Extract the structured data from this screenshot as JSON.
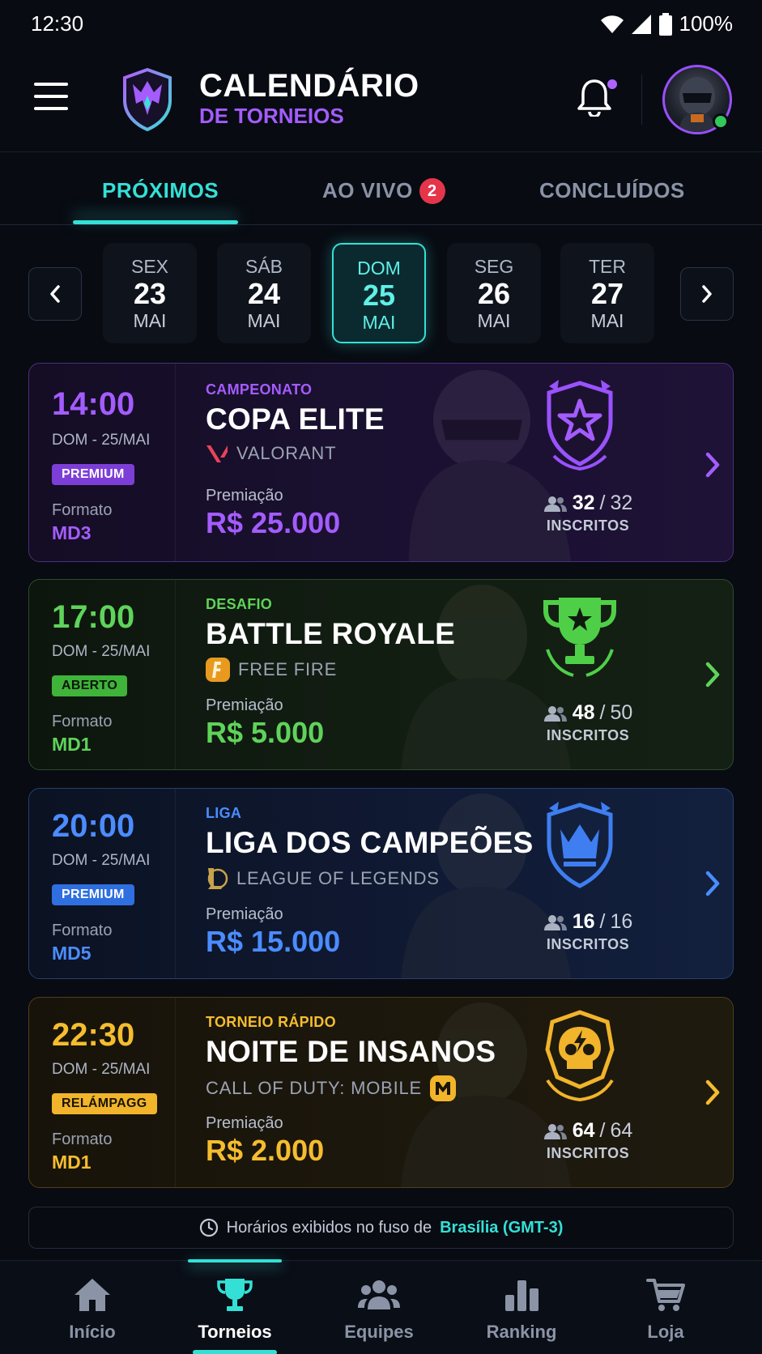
{
  "status_bar": {
    "time": "12:30",
    "battery": "100%"
  },
  "header": {
    "title_line1": "CALENDÁRIO",
    "title_line2": "DE TORNEIOS"
  },
  "tabs": [
    {
      "label": "PRÓXIMOS",
      "active": true
    },
    {
      "label": "AO VIVO",
      "badge": "2",
      "active": false
    },
    {
      "label": "CONCLUÍDOS",
      "active": false
    }
  ],
  "dates": [
    {
      "weekday": "SEX",
      "day": "23",
      "month": "MAI",
      "active": false
    },
    {
      "weekday": "SÁB",
      "day": "24",
      "month": "MAI",
      "active": false
    },
    {
      "weekday": "DOM",
      "day": "25",
      "month": "MAI",
      "active": true
    },
    {
      "weekday": "SEG",
      "day": "26",
      "month": "MAI",
      "active": false
    },
    {
      "weekday": "TER",
      "day": "27",
      "month": "MAI",
      "active": false
    }
  ],
  "tournaments": [
    {
      "time": "14:00",
      "date": "DOM - 25/MAI",
      "badge": "PREMIUM",
      "format_label": "Formato",
      "format": "MD3",
      "category": "CAMPEONATO",
      "name": "COPA ELITE",
      "game": "VALORANT",
      "game_icon": "valorant-icon",
      "prize_label": "Premiação",
      "prize": "R$ 25.000",
      "registered": "32",
      "capacity": "32",
      "registered_label": "INSCRITOS",
      "accent": "#a45cff",
      "emblem": "star-shield-icon"
    },
    {
      "time": "17:00",
      "date": "DOM - 25/MAI",
      "badge": "ABERTO",
      "format_label": "Formato",
      "format": "MD1",
      "category": "DESAFIO",
      "name": "BATTLE ROYALE",
      "game": "FREE FIRE",
      "game_icon": "free-fire-icon",
      "prize_label": "Premiação",
      "prize": "R$ 5.000",
      "registered": "48",
      "capacity": "50",
      "registered_label": "INSCRITOS",
      "accent": "#5fd35a",
      "emblem": "trophy-icon"
    },
    {
      "time": "20:00",
      "date": "DOM - 25/MAI",
      "badge": "PREMIUM",
      "format_label": "Formato",
      "format": "MD5",
      "category": "LIGA",
      "name": "LIGA DOS CAMPEÕES",
      "game": "LEAGUE OF LEGENDS",
      "game_icon": "league-icon",
      "prize_label": "Premiação",
      "prize": "R$ 15.000",
      "registered": "16",
      "capacity": "16",
      "registered_label": "INSCRITOS",
      "accent": "#4b8cff",
      "emblem": "crown-shield-icon"
    },
    {
      "time": "22:30",
      "date": "DOM - 25/MAI",
      "badge": "RELÁMPAGG",
      "format_label": "Formato",
      "format": "MD1",
      "category": "TORNEIO RÁPIDO",
      "name": "NOITE DE INSANOS",
      "game": "CALL OF DUTY: MOBILE",
      "game_icon": "cod-mobile-icon",
      "prize_label": "Premiação",
      "prize": "R$ 2.000",
      "registered": "64",
      "capacity": "64",
      "registered_label": "INSCRITOS",
      "accent": "#f5bd2e",
      "emblem": "skull-icon"
    }
  ],
  "timezone_note": {
    "text": "Horários exibidos no fuso de",
    "zone": "Brasília (GMT-3)"
  },
  "bottom_nav": [
    {
      "label": "Início",
      "icon": "home-icon",
      "active": false
    },
    {
      "label": "Torneios",
      "icon": "trophy-icon",
      "active": true
    },
    {
      "label": "Equipes",
      "icon": "group-icon",
      "active": false
    },
    {
      "label": "Ranking",
      "icon": "bar-chart-icon",
      "active": false
    },
    {
      "label": "Loja",
      "icon": "cart-icon",
      "active": false
    }
  ]
}
